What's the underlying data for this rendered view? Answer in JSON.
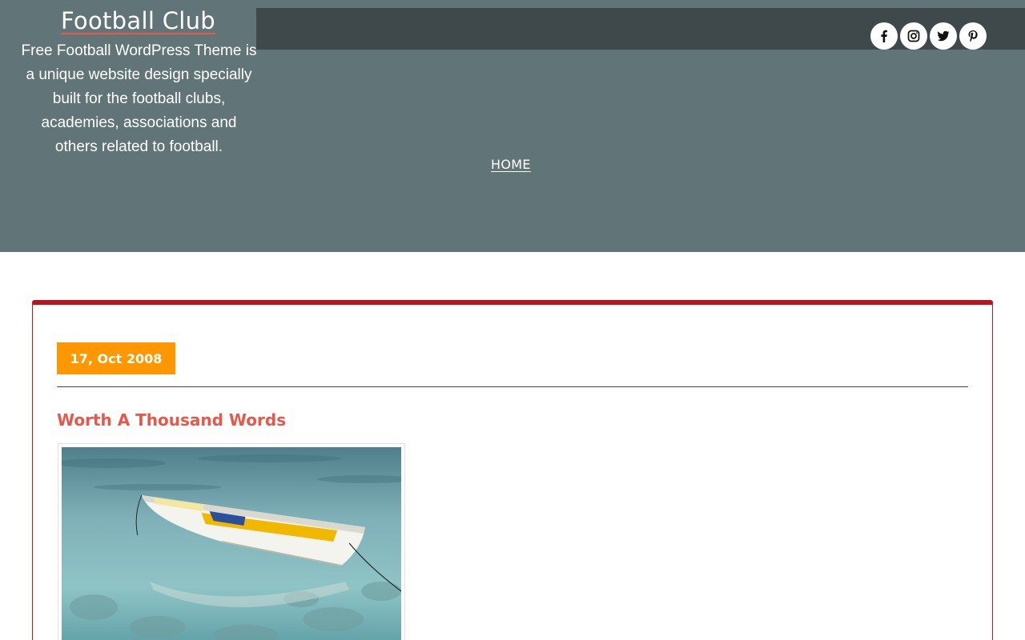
{
  "site": {
    "title": "Football Club",
    "description": "Free Football WordPress Theme is a unique website design specially built for the football clubs, academies, associations and others related to football."
  },
  "social": [
    "facebook-icon",
    "instagram-icon",
    "twitter-icon",
    "pinterest-icon"
  ],
  "nav": {
    "home_label": "HOME"
  },
  "post": {
    "date": "17, Oct 2008",
    "title": "Worth A Thousand Words"
  },
  "colors": {
    "header_bg": "#617477",
    "topbar_bg": "#3f484a",
    "accent": "#e8574a",
    "date_badge": "#ff9800",
    "card_border": "#c0121a"
  }
}
